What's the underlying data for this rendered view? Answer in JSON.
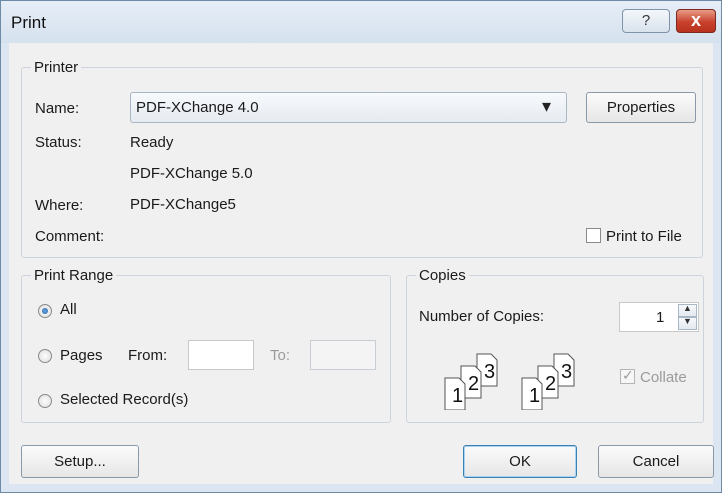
{
  "window": {
    "title": "Print"
  },
  "icons": {
    "help": "?",
    "close": "x",
    "dropdown": "▾",
    "up": "▲",
    "down": "▼",
    "check": "✓"
  },
  "printer": {
    "legend": "Printer",
    "name_label": "Name:",
    "name_value": "PDF-XChange 4.0",
    "properties_label": "Properties",
    "status_label": "Status:",
    "status_value": "Ready",
    "type_value": "PDF-XChange 5.0",
    "where_label": "Where:",
    "where_value": "PDF-XChange5",
    "comment_label": "Comment:",
    "print_to_file_label": "Print to File",
    "print_to_file_checked": false
  },
  "range": {
    "legend": "Print Range",
    "all_label": "All",
    "pages_label": "Pages",
    "from_label": "From:",
    "to_label": "To:",
    "selected_label": "Selected Record(s)",
    "selected_option": "All"
  },
  "copies": {
    "legend": "Copies",
    "number_label": "Number of Copies:",
    "number_value": "1",
    "collate_label": "Collate",
    "collate_checked": true,
    "page_numbers": [
      "1",
      "2",
      "3"
    ]
  },
  "footer": {
    "setup_label": "Setup...",
    "ok_label": "OK",
    "cancel_label": "Cancel"
  }
}
